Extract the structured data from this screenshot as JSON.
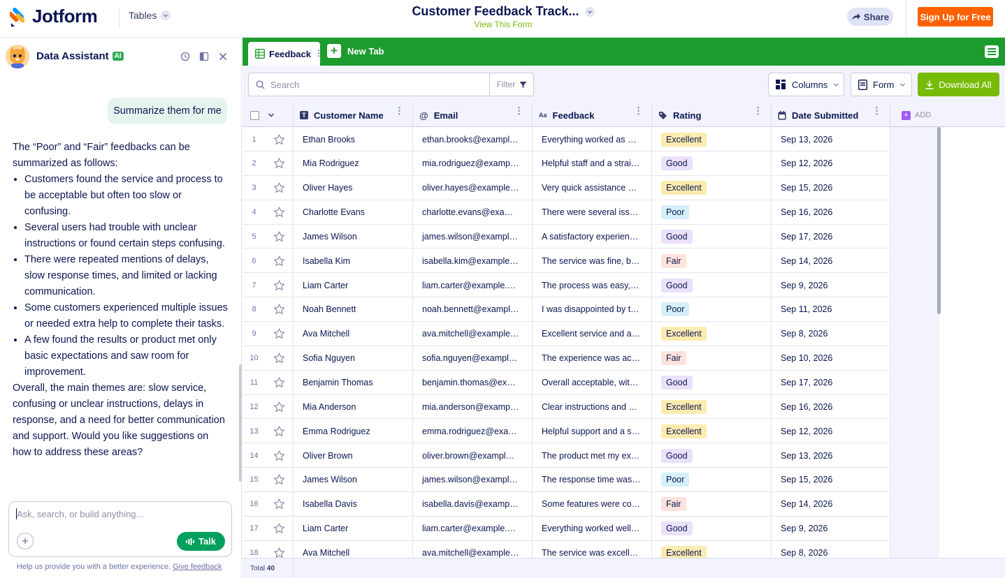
{
  "header": {
    "brand": "Jotform",
    "nav_tables": "Tables",
    "title": "Customer Feedback Track...",
    "subtitle_link": "View This Form",
    "share": "Share",
    "signup": "Sign Up for Free"
  },
  "assistant": {
    "name": "Data Assistant",
    "badge": "AI",
    "user_message": "Summarize them for me",
    "reply_intro": "The “Poor” and “Fair” feedbacks can be summarized as follows:",
    "reply_bullets": [
      "Customers found the service and process to be acceptable but often too slow or confusing.",
      "Several users had trouble with unclear instructions or found certain steps confusing.",
      "There were repeated mentions of delays, slow response times, and limited or lacking communication.",
      "Some customers experienced multiple issues or needed extra help to complete their tasks.",
      "A few found the results or product met only basic expectations and saw room for improvement."
    ],
    "reply_outro": "Overall, the main themes are: slow service, confusing or unclear instructions, delays in response, and a need for better communication and support. Would you like suggestions on how to address these areas?",
    "input_placeholder": "Ask, search, or build anything...",
    "talk": "Talk",
    "footer_text": "Help us provide you with a better experience.",
    "footer_link": "Give feedback"
  },
  "tabs": {
    "active": "Feedback",
    "new_tab": "New Tab"
  },
  "toolbar": {
    "search_placeholder": "Search",
    "filter": "Filter",
    "columns": "Columns",
    "form": "Form",
    "download": "Download All"
  },
  "table": {
    "columns": [
      "Customer Name",
      "Email",
      "Feedback",
      "Rating",
      "Date Submitted"
    ],
    "add_column": "ADD",
    "total_label": "Total",
    "total_value": "40",
    "rows": [
      {
        "n": "1",
        "name": "Ethan Brooks",
        "email": "ethan.brooks@example.com",
        "feedback": "Everything worked as expected",
        "rating": "Excellent",
        "date": "Sep 13, 2026"
      },
      {
        "n": "2",
        "name": "Mia Rodriguez",
        "email": "mia.rodriguez@example.com",
        "feedback": "Helpful staff and a straightforward process",
        "rating": "Good",
        "date": "Sep 12, 2026"
      },
      {
        "n": "3",
        "name": "Oliver Hayes",
        "email": "oliver.hayes@example.com",
        "feedback": "Very quick assistance and friendly support",
        "rating": "Excellent",
        "date": "Sep 15, 2026"
      },
      {
        "n": "4",
        "name": "Charlotte Evans",
        "email": "charlotte.evans@example.com",
        "feedback": "There were several issues during the process",
        "rating": "Poor",
        "date": "Sep 16, 2026"
      },
      {
        "n": "5",
        "name": "James Wilson",
        "email": "james.wilson@example.com",
        "feedback": "A satisfactory experience overall",
        "rating": "Good",
        "date": "Sep 17, 2026"
      },
      {
        "n": "6",
        "name": "Isabella Kim",
        "email": "isabella.kim@example.com",
        "feedback": "The service was fine, but slow",
        "rating": "Fair",
        "date": "Sep 14, 2026"
      },
      {
        "n": "7",
        "name": "Liam Carter",
        "email": "liam.carter@example.com",
        "feedback": "The process was easy, thanks",
        "rating": "Good",
        "date": "Sep 9, 2026"
      },
      {
        "n": "8",
        "name": "Noah Bennett",
        "email": "noah.bennett@example.com",
        "feedback": "I was disappointed by the delays",
        "rating": "Poor",
        "date": "Sep 11, 2026"
      },
      {
        "n": "9",
        "name": "Ava Mitchell",
        "email": "ava.mitchell@example.com",
        "feedback": "Excellent service and a smooth process",
        "rating": "Excellent",
        "date": "Sep 8, 2026"
      },
      {
        "n": "10",
        "name": "Sofia Nguyen",
        "email": "sofia.nguyen@example.com",
        "feedback": "The experience was acceptable",
        "rating": "Fair",
        "date": "Sep 10, 2026"
      },
      {
        "n": "11",
        "name": "Benjamin Thomas",
        "email": "benjamin.thomas@example.com",
        "feedback": "Overall acceptable, with minor issues",
        "rating": "Good",
        "date": "Sep 17, 2026"
      },
      {
        "n": "12",
        "name": "Mia Anderson",
        "email": "mia.anderson@example.com",
        "feedback": "Clear instructions and quick delivery",
        "rating": "Excellent",
        "date": "Sep 16, 2026"
      },
      {
        "n": "13",
        "name": "Emma Rodriguez",
        "email": "emma.rodriguez@example.com",
        "feedback": "Helpful support and a smooth process",
        "rating": "Excellent",
        "date": "Sep 12, 2026"
      },
      {
        "n": "14",
        "name": "Oliver Brown",
        "email": "oliver.brown@example.com",
        "feedback": "The product met my expectations",
        "rating": "Good",
        "date": "Sep 13, 2026"
      },
      {
        "n": "15",
        "name": "James Wilson",
        "email": "james.wilson@example.com",
        "feedback": "The response time was slow",
        "rating": "Poor",
        "date": "Sep 15, 2026"
      },
      {
        "n": "16",
        "name": "Isabella Davis",
        "email": "isabella.davis@example.com",
        "feedback": "Some features were confusing",
        "rating": "Fair",
        "date": "Sep 14, 2026"
      },
      {
        "n": "17",
        "name": "Liam Carter",
        "email": "liam.carter@example.com",
        "feedback": "Everything worked well, thanks",
        "rating": "Good",
        "date": "Sep 9, 2026"
      },
      {
        "n": "18",
        "name": "Ava Mitchell",
        "email": "ava.mitchell@example.com",
        "feedback": "The service was excellent overall",
        "rating": "Excellent",
        "date": "Sep 8, 2026"
      }
    ]
  },
  "colors": {
    "brand_green": "#1d9c2d",
    "signup_orange": "#ff6100",
    "download_green": "#78bb07",
    "rating": {
      "Excellent": {
        "bg": "#fdebb0",
        "fg": "#0a1551"
      },
      "Good": {
        "bg": "#ebe1fb",
        "fg": "#0a1551"
      },
      "Poor": {
        "bg": "#d6f0fb",
        "fg": "#0a1551"
      },
      "Fair": {
        "bg": "#fde3dc",
        "fg": "#0a1551"
      }
    }
  }
}
